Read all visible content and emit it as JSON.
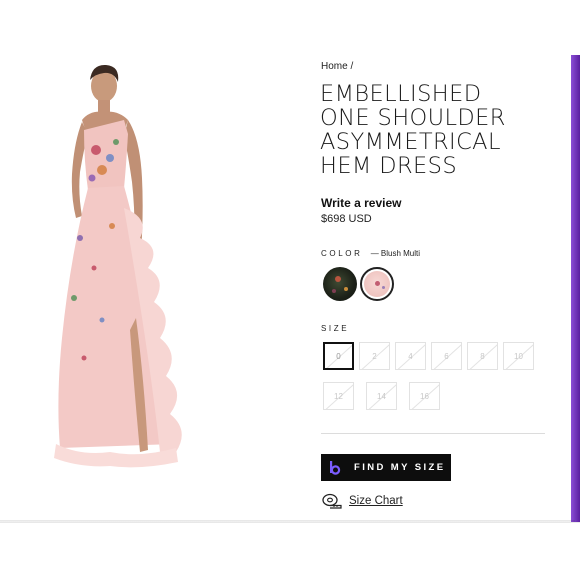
{
  "breadcrumb": {
    "home": "Home",
    "separator": "/"
  },
  "product": {
    "title_lines": [
      "EMBELLISHED",
      "ONE SHOULDER",
      "ASYMMETRICAL",
      "HEM DRESS"
    ],
    "review_label": "Write a review",
    "price": "$698 USD"
  },
  "color": {
    "label": "COLOR",
    "selected": "— Blush Multi",
    "swatches": [
      {
        "name": "Black Multi",
        "hex": "#1c2118"
      },
      {
        "name": "Blush Multi",
        "hex": "#efc4c0"
      }
    ]
  },
  "size": {
    "label": "SIZE",
    "options": [
      "0",
      "2",
      "4",
      "6",
      "8",
      "10",
      "12",
      "14",
      "16"
    ],
    "selected": "0"
  },
  "actions": {
    "find_my_size": "FIND MY SIZE",
    "size_chart": "Size Chart"
  },
  "colors": {
    "accent_purple": "#8b4fd6",
    "button_bg": "#0d0d0d",
    "dress_pink": "#f3c9c6"
  }
}
